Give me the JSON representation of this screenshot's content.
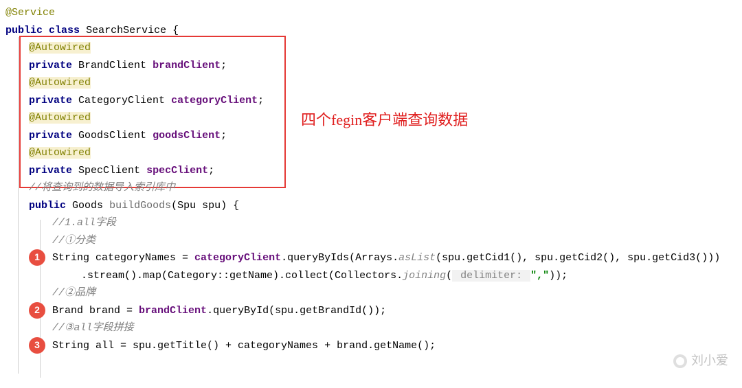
{
  "annotation": {
    "service": "@Service",
    "autowired": "@Autowired"
  },
  "decl": {
    "public": "public",
    "private": "private",
    "class": "class",
    "className": "SearchService",
    "openBrace": "{"
  },
  "fields": {
    "brandType": "BrandClient",
    "brandName": "brandClient",
    "categoryType": "CategoryClient",
    "categoryName": "categoryClient",
    "goodsType": "GoodsClient",
    "goodsName": "goodsClient",
    "specType": "SpecClient",
    "specName": "specClient",
    "semi": ";"
  },
  "redBoxLabel": "四个fegin客户端查询数据",
  "comment": {
    "importIndex": "//将查询到的数据导入索引库中",
    "allField": "//1.all字段",
    "catSub": "//①分类",
    "brandSub": "//②品牌",
    "concatSub": "//③all字段拼接"
  },
  "method": {
    "sigPublic": "public",
    "sigReturn": "Goods",
    "sigName": "buildGoods",
    "sigParamType": "Spu",
    "sigParamName": "spu",
    "openBrace": "{"
  },
  "code": {
    "line1a": "String categoryNames = ",
    "line1field": "categoryClient",
    "line1tail": ".queryByIds(Arrays.",
    "line1asList": "asList",
    "line1args": "(spu.getCid1(),  spu.getCid2(),  spu.getCid3()))",
    "line1b_head": ".stream().map(Category::getName).collect(Collectors.",
    "line1b_join": "joining",
    "line1b_paren": "(",
    "line1b_hint": " delimiter: ",
    "line1b_str": "\",\"",
    "line1b_close": "));",
    "line2a": "Brand brand = ",
    "line2field": "brandClient",
    "line2tail": ".queryById(spu.getBrandId());",
    "line3": "String all = spu.getTitle() + categoryNames + brand.getName();"
  },
  "bullets": {
    "b1": "1",
    "b2": "2",
    "b3": "3"
  },
  "watermark": "刘小爱"
}
